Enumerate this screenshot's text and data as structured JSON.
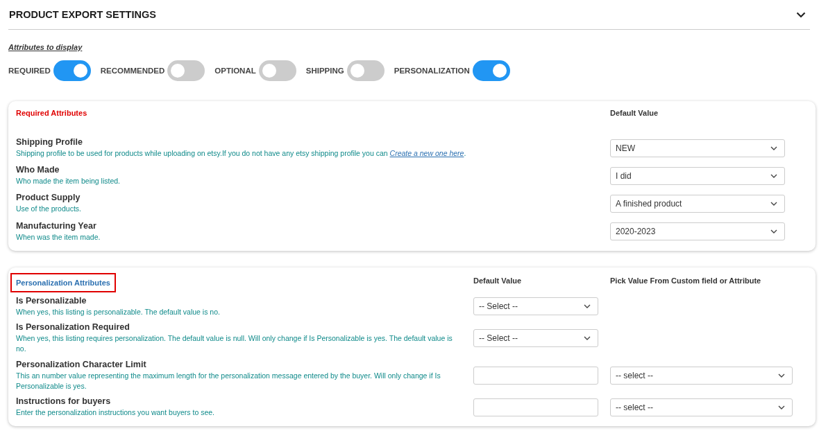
{
  "panel": {
    "title": "PRODUCT EXPORT SETTINGS",
    "expanded": true
  },
  "attributes_label": "Attributes to display",
  "toggles": [
    {
      "label": "REQUIRED",
      "on": true
    },
    {
      "label": "RECOMMENDED",
      "on": false
    },
    {
      "label": "OPTIONAL",
      "on": false
    },
    {
      "label": "SHIPPING",
      "on": false
    },
    {
      "label": "PERSONALIZATION",
      "on": true
    }
  ],
  "sections": [
    {
      "title": "Required Attributes",
      "color": "#e00000",
      "outlined": false,
      "columns": [
        "Default Value"
      ],
      "rows": [
        {
          "name": "Shipping Profile",
          "description": "Shipping profile to be used for products while uploading on etsy.If you do not have any etsy shipping profile you can ",
          "link": "Create a new one here",
          "link_suffix": ".",
          "default": {
            "kind": "select",
            "value": "NEW"
          }
        },
        {
          "name": "Who Made",
          "description": "Who made the item being listed.",
          "default": {
            "kind": "select",
            "value": "I did"
          }
        },
        {
          "name": "Product Supply",
          "description": "Use of the products.",
          "default": {
            "kind": "select",
            "value": "A finished product"
          }
        },
        {
          "name": "Manufacturing Year",
          "description": "When was the item made.",
          "default": {
            "kind": "select",
            "value": "2020-2023"
          }
        }
      ]
    },
    {
      "title": "Personalization Attributes",
      "color": "#2a6fb0",
      "outlined": true,
      "columns": [
        "Default Value",
        "Pick Value From Custom field or Attribute"
      ],
      "rows": [
        {
          "name": "Is Personalizable",
          "description": "When yes, this listing is personalizable. The default value is no.",
          "default": {
            "kind": "select",
            "value": "-- Select --"
          }
        },
        {
          "name": "Is Personalization Required",
          "description": "When yes, this listing requires personalization. The default value is null. Will only change if Is Personalizable is yes. The default value is no.",
          "default": {
            "kind": "select",
            "value": "-- Select --"
          }
        },
        {
          "name": "Personalization Character Limit",
          "description": "This an number value representing the maximum length for the personalization message entered by the buyer. Will only change if Is Personalizable is yes.",
          "default": {
            "kind": "text"
          },
          "pick": {
            "kind": "select",
            "value": "-- select --"
          }
        },
        {
          "name": "Instructions for buyers",
          "description": "Enter the personalization instructions you want buyers to see.",
          "default": {
            "kind": "text"
          },
          "pick": {
            "kind": "select",
            "value": "-- select --"
          }
        }
      ]
    }
  ]
}
